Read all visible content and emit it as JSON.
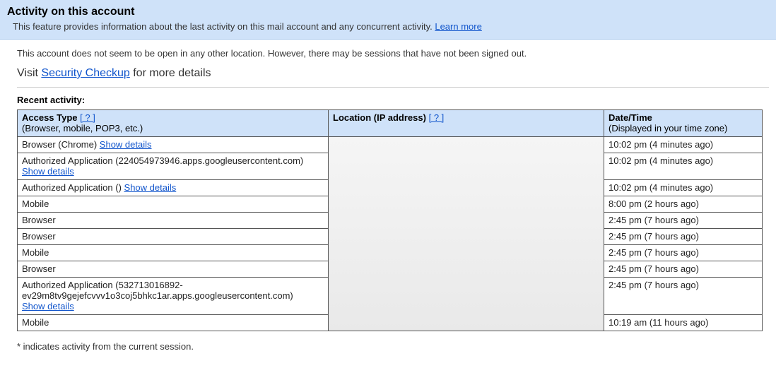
{
  "banner": {
    "title": "Activity on this account",
    "description_prefix": "This feature provides information about the last activity on this mail account and any concurrent activity. ",
    "learn_more": "Learn more"
  },
  "status_line": "This account does not seem to be open in any other location. However, there may be sessions that have not been signed out.",
  "visit_prefix": "Visit ",
  "visit_link": "Security Checkup",
  "visit_suffix": " for more details",
  "recent_activity_heading": "Recent activity:",
  "headers": {
    "access_main": "Access Type",
    "access_q": "[ ? ]",
    "access_sub": "(Browser, mobile, POP3, etc.)",
    "location_main": "Location (IP address)",
    "location_q": "[ ? ]",
    "date_main": "Date/Time",
    "date_sub": "(Displayed in your time zone)"
  },
  "show_details_label": "Show details",
  "rows": [
    {
      "access_text": "Browser (Chrome) ",
      "show_details": true,
      "datetime": "10:02 pm (4 minutes ago)"
    },
    {
      "access_text": "Authorized Application (224054973946.apps.googleusercontent.com)",
      "show_details_newline": true,
      "datetime": "10:02 pm (4 minutes ago)"
    },
    {
      "access_text": "Authorized Application () ",
      "show_details": true,
      "datetime": "10:02 pm (4 minutes ago)"
    },
    {
      "access_text": "Mobile",
      "datetime": "8:00 pm (2 hours ago)"
    },
    {
      "access_text": "Browser",
      "datetime": "2:45 pm (7 hours ago)"
    },
    {
      "access_text": "Browser",
      "datetime": "2:45 pm (7 hours ago)"
    },
    {
      "access_text": "Mobile",
      "datetime": "2:45 pm (7 hours ago)"
    },
    {
      "access_text": "Browser",
      "datetime": "2:45 pm (7 hours ago)"
    },
    {
      "access_text": "Authorized Application (532713016892-ev29m8tv9gejefcvvv1o3coj5bhkc1ar.apps.googleusercontent.com)",
      "show_details_newline": true,
      "datetime": "2:45 pm (7 hours ago)"
    },
    {
      "access_text": "Mobile",
      "datetime": "10:19 am (11 hours ago)"
    }
  ],
  "footnote": "* indicates activity from the current session."
}
